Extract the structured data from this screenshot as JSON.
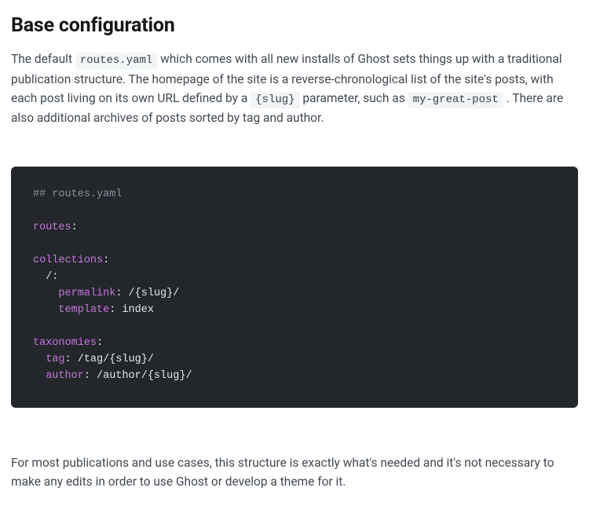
{
  "heading": "Base configuration",
  "para1_a": "The default ",
  "code1": "routes.yaml",
  "para1_b": " which comes with all new installs of Ghost sets things up with a traditional publication structure. The homepage of the site is a reverse-chronological list of the site's posts, with each post living on its own URL defined by a ",
  "code2": "{slug}",
  "para1_c": " parameter, such as ",
  "code3": "my-great-post",
  "para1_d": " . There are also additional archives of posts sorted by tag and author.",
  "codeblock": {
    "l1": "## routes.yaml",
    "l3k": "routes",
    "l5k": "collections",
    "l6v": "  /:",
    "l7k": "    permalink",
    "l7v": " /{slug}/",
    "l8k": "    template",
    "l8v": " index",
    "l10k": "taxonomies",
    "l11k": "  tag",
    "l11v": " /tag/{slug}/",
    "l12k": "  author",
    "l12v": " /author/{slug}/"
  },
  "para2": "For most publications and use cases, this structure is exactly what's needed and it's not necessary to make any edits in order to use Ghost or develop a theme for it."
}
